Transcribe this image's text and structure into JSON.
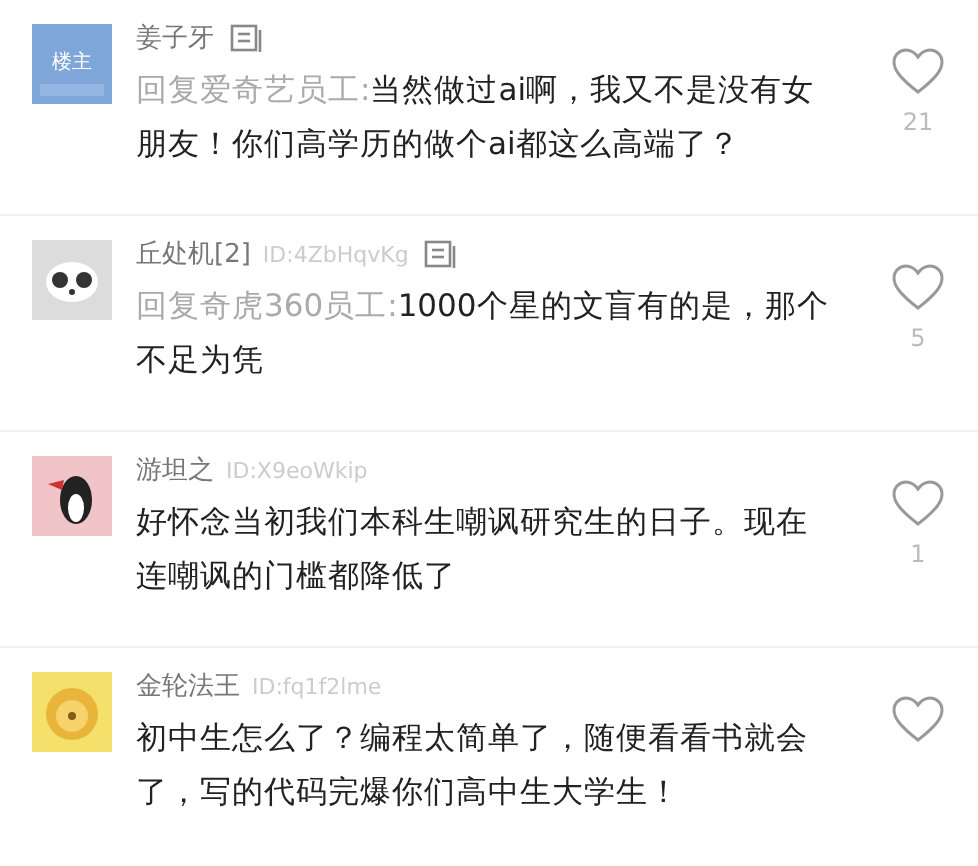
{
  "comments": [
    {
      "avatar_label": "楼主",
      "name": "姜子牙",
      "has_note": true,
      "reply_to": "回复爱奇艺员工:",
      "text": "当然做过ai啊，我又不是没有女朋友！你们高学历的做个ai都这么高端了？",
      "likes": "21"
    },
    {
      "name": "丘处机[2]",
      "id": "ID:4ZbHqvKg",
      "has_note": true,
      "reply_to": "回复奇虎360员工:",
      "text": "1000个星的文盲有的是，那个不足为凭",
      "likes": "5"
    },
    {
      "name": "游坦之",
      "id": "ID:X9eoWkip",
      "has_note": false,
      "text": "好怀念当初我们本科生嘲讽研究生的日子。现在连嘲讽的门槛都降低了",
      "likes": "1"
    },
    {
      "name": "金轮法王",
      "id": "ID:fq1f2lme",
      "has_note": false,
      "text": "初中生怎么了？编程太简单了，随便看看书就会了，写的代码完爆你们高中生大学生！"
    }
  ]
}
